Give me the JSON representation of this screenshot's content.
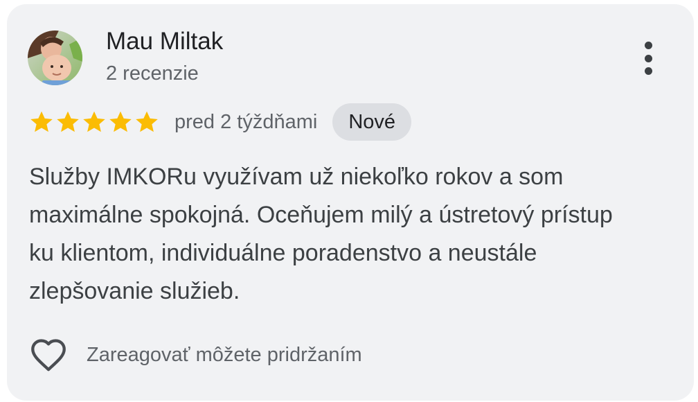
{
  "review": {
    "author": {
      "name": "Mau Miltak",
      "meta": "2 recenzie",
      "avatar_icon": "profile-photo"
    },
    "menu_icon": "more-vert-icon",
    "rating": {
      "value": 5,
      "max": 5,
      "star_color": "#fbbc04"
    },
    "date": "pred 2 týždňami",
    "badge": "Nové",
    "text": "Služby IMKORu využívam už niekoľko rokov a som maximálne spokojná. Oceňujem milý a ústretový prístup ku klientom, individuálne poradenstvo a neustále zlepšovanie služieb.",
    "reaction": {
      "icon": "heart-outline-icon",
      "hint": "Zareagovať môžete pridržaním"
    }
  }
}
